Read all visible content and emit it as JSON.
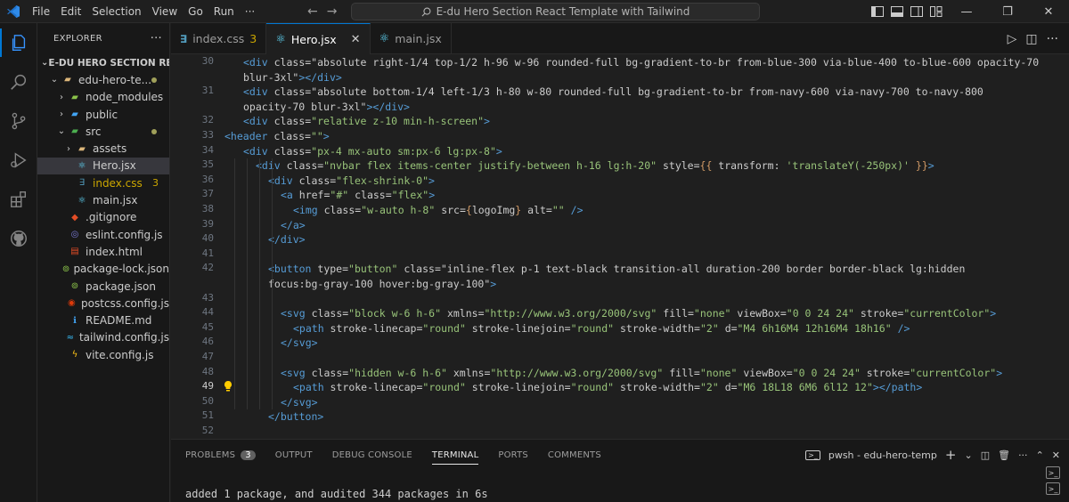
{
  "menu": [
    "File",
    "Edit",
    "Selection",
    "View",
    "Go",
    "Run",
    "···"
  ],
  "search_title": "E-du Hero Section React Template with Tailwind",
  "window_controls": {
    "minimize": "—",
    "restore": "❐",
    "close": "✕"
  },
  "explorer": {
    "title": "EXPLORER",
    "more": "···",
    "root": "E-DU HERO SECTION REAC...",
    "items": [
      {
        "label": "edu-hero-te...",
        "indent": 1,
        "chev": "v",
        "icon": "folder"
      },
      {
        "label": "node_modules",
        "indent": 2,
        "chev": ">",
        "icon": "folder-node"
      },
      {
        "label": "public",
        "indent": 2,
        "chev": ">",
        "icon": "folder-public"
      },
      {
        "label": "src",
        "indent": 2,
        "chev": "v",
        "icon": "folder-src"
      },
      {
        "label": "assets",
        "indent": 3,
        "chev": ">",
        "icon": "folder"
      },
      {
        "label": "Hero.jsx",
        "indent": 3,
        "chev": "",
        "icon": "react"
      },
      {
        "label": "index.css",
        "indent": 3,
        "chev": "",
        "icon": "css",
        "badge": "3"
      },
      {
        "label": "main.jsx",
        "indent": 3,
        "chev": "",
        "icon": "react"
      },
      {
        "label": ".gitignore",
        "indent": 2,
        "chev": "",
        "icon": "git"
      },
      {
        "label": "eslint.config.js",
        "indent": 2,
        "chev": "",
        "icon": "eslint"
      },
      {
        "label": "index.html",
        "indent": 2,
        "chev": "",
        "icon": "html"
      },
      {
        "label": "package-lock.json",
        "indent": 2,
        "chev": "",
        "icon": "npm"
      },
      {
        "label": "package.json",
        "indent": 2,
        "chev": "",
        "icon": "npm"
      },
      {
        "label": "postcss.config.js",
        "indent": 2,
        "chev": "",
        "icon": "postcss"
      },
      {
        "label": "README.md",
        "indent": 2,
        "chev": "",
        "icon": "info"
      },
      {
        "label": "tailwind.config.js",
        "indent": 2,
        "chev": "",
        "icon": "tailwind"
      },
      {
        "label": "vite.config.js",
        "indent": 2,
        "chev": "",
        "icon": "vite"
      }
    ]
  },
  "tabs": [
    {
      "label": "index.css",
      "badge": "3",
      "icon": "css"
    },
    {
      "label": "Hero.jsx",
      "icon": "react",
      "active": true,
      "close": "✕"
    },
    {
      "label": "main.jsx",
      "icon": "react"
    }
  ],
  "gutter": [
    "30",
    "",
    "31",
    "",
    "32",
    "33",
    "34",
    "35",
    "36",
    "37",
    "38",
    "39",
    "40",
    "41",
    "42",
    "",
    "43",
    "44",
    "45",
    "46",
    "47",
    "48",
    "49",
    "50",
    "51",
    "52"
  ],
  "current_line": "49",
  "code_lines": [
    "<div class=\"absolute right-1/4 top-1/2 h-96 w-96 rounded-full bg-gradient-to-br from-blue-300 via-blue-400 to-blue-600 opacity-70",
    "blur-3xl\"></div>",
    "<div class=\"absolute bottom-1/4 left-1/3 h-80 w-80 rounded-full bg-gradient-to-br from-navy-600 via-navy-700 to-navy-800",
    "opacity-70 blur-3xl\"></div>",
    "<div class=\"relative z-10 min-h-screen\">",
    "<header class=\"\">",
    "<div class=\"px-4 mx-auto sm:px-6 lg:px-8\">",
    "<div class=\"nvbar flex items-center justify-between h-16 lg:h-20\" style={{ transform: 'translateY(-250px)' }}>",
    "<div class=\"flex-shrink-0\">",
    "<a href=\"#\" class=\"flex\">",
    "<img class=\"w-auto h-8\" src={logoImg} alt=\"\" />",
    "</a>",
    "</div>",
    "",
    "<button type=\"button\" class=\"inline-flex p-1 text-black transition-all duration-200 border border-black lg:hidden",
    "focus:bg-gray-100 hover:bg-gray-100\">",
    "",
    "<svg class=\"block w-6 h-6\" xmlns=\"http://www.w3.org/2000/svg\" fill=\"none\" viewBox=\"0 0 24 24\" stroke=\"currentColor\">",
    "<path stroke-linecap=\"round\" stroke-linejoin=\"round\" stroke-width=\"2\" d=\"M4 6h16M4 12h16M4 18h16\" />",
    "</svg>",
    "",
    "<svg class=\"hidden w-6 h-6\" xmlns=\"http://www.w3.org/2000/svg\" fill=\"none\" viewBox=\"0 0 24 24\" stroke=\"currentColor\">",
    "<path stroke-linecap=\"round\" stroke-linejoin=\"round\" stroke-width=\"2\" d=\"M6 18L18 6M6 6l12 12\"></path>",
    "</svg>",
    "</button>",
    ""
  ],
  "panel": {
    "tabs": [
      "PROBLEMS",
      "OUTPUT",
      "DEBUG CONSOLE",
      "TERMINAL",
      "PORTS",
      "COMMENTS"
    ],
    "problems_count": "3",
    "active_tab": "TERMINAL",
    "terminal_name": "pwsh - edu-hero-temp",
    "terminal_output": "added 1 package, and audited 344 packages in 6s"
  },
  "colors": {
    "accent": "#0078d4",
    "warning": "#cca700",
    "tag": "#569cd6",
    "attr": "#e06c75",
    "string": "#98c379"
  }
}
